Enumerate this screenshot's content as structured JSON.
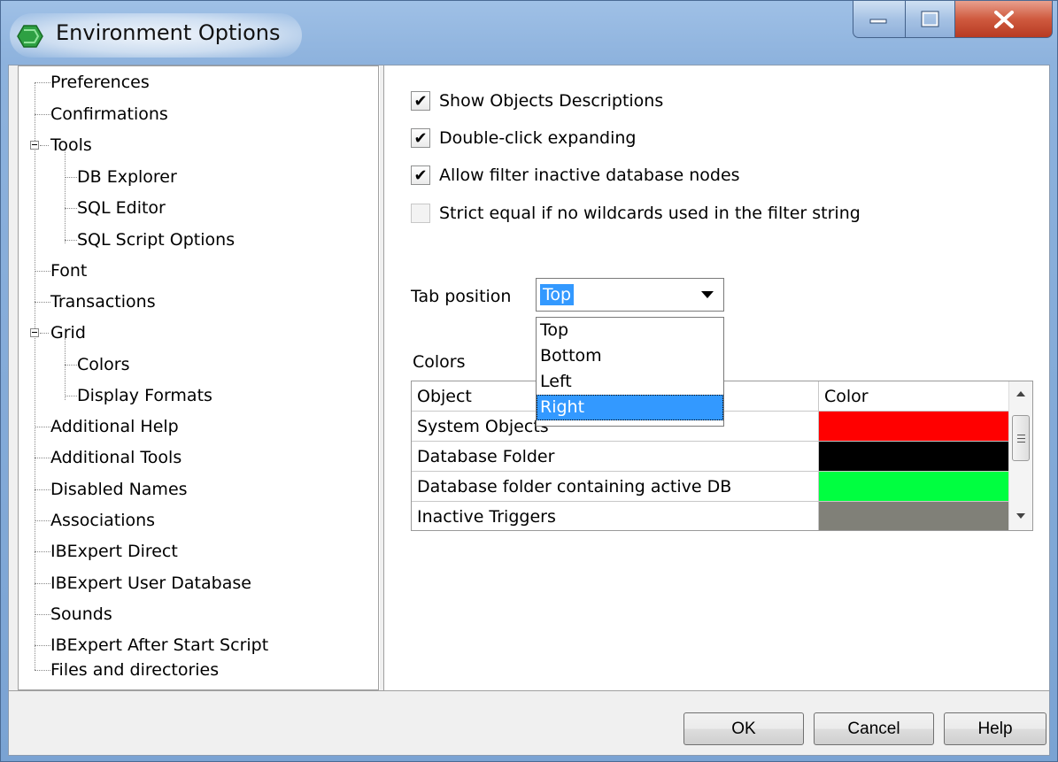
{
  "window": {
    "title": "Environment Options",
    "buttons": {
      "minimize": "minimize-icon",
      "maximize": "maximize-icon",
      "close": "close-icon"
    }
  },
  "tree": {
    "items": [
      {
        "label": "Preferences"
      },
      {
        "label": "Confirmations"
      },
      {
        "label": "Tools"
      },
      {
        "label": "DB Explorer"
      },
      {
        "label": "SQL Editor"
      },
      {
        "label": "SQL Script Options"
      },
      {
        "label": "Font"
      },
      {
        "label": "Transactions"
      },
      {
        "label": "Grid"
      },
      {
        "label": "Colors"
      },
      {
        "label": "Display Formats"
      },
      {
        "label": "Additional Help"
      },
      {
        "label": "Additional Tools"
      },
      {
        "label": "Disabled Names"
      },
      {
        "label": "Associations"
      },
      {
        "label": "IBExpert Direct"
      },
      {
        "label": "IBExpert User Database"
      },
      {
        "label": "Sounds"
      },
      {
        "label": "IBExpert After Start Script"
      },
      {
        "label": "Files and directories"
      }
    ]
  },
  "options": {
    "checkboxes": [
      {
        "label": "Show Objects Descriptions",
        "checked": true
      },
      {
        "label": "Double-click expanding",
        "checked": true
      },
      {
        "label": "Allow filter inactive database nodes",
        "checked": true
      },
      {
        "label": "Strict equal if no wildcards used in the filter string",
        "checked": false
      }
    ],
    "tab_position": {
      "label": "Tab position",
      "value": "Top",
      "options": [
        "Top",
        "Bottom",
        "Left",
        "Right"
      ],
      "highlighted": "Right"
    },
    "colors": {
      "label": "Colors",
      "headers": {
        "object": "Object",
        "color": "Color"
      },
      "rows": [
        {
          "object": "System Objects",
          "color": "#ff0000"
        },
        {
          "object": "Database Folder",
          "color": "#000000"
        },
        {
          "object": "Database folder containing active DB",
          "color": "#00ff40"
        },
        {
          "object": "Inactive Triggers",
          "color": "#808078"
        }
      ]
    }
  },
  "buttons": {
    "ok": "OK",
    "cancel": "Cancel",
    "help": "Help"
  }
}
